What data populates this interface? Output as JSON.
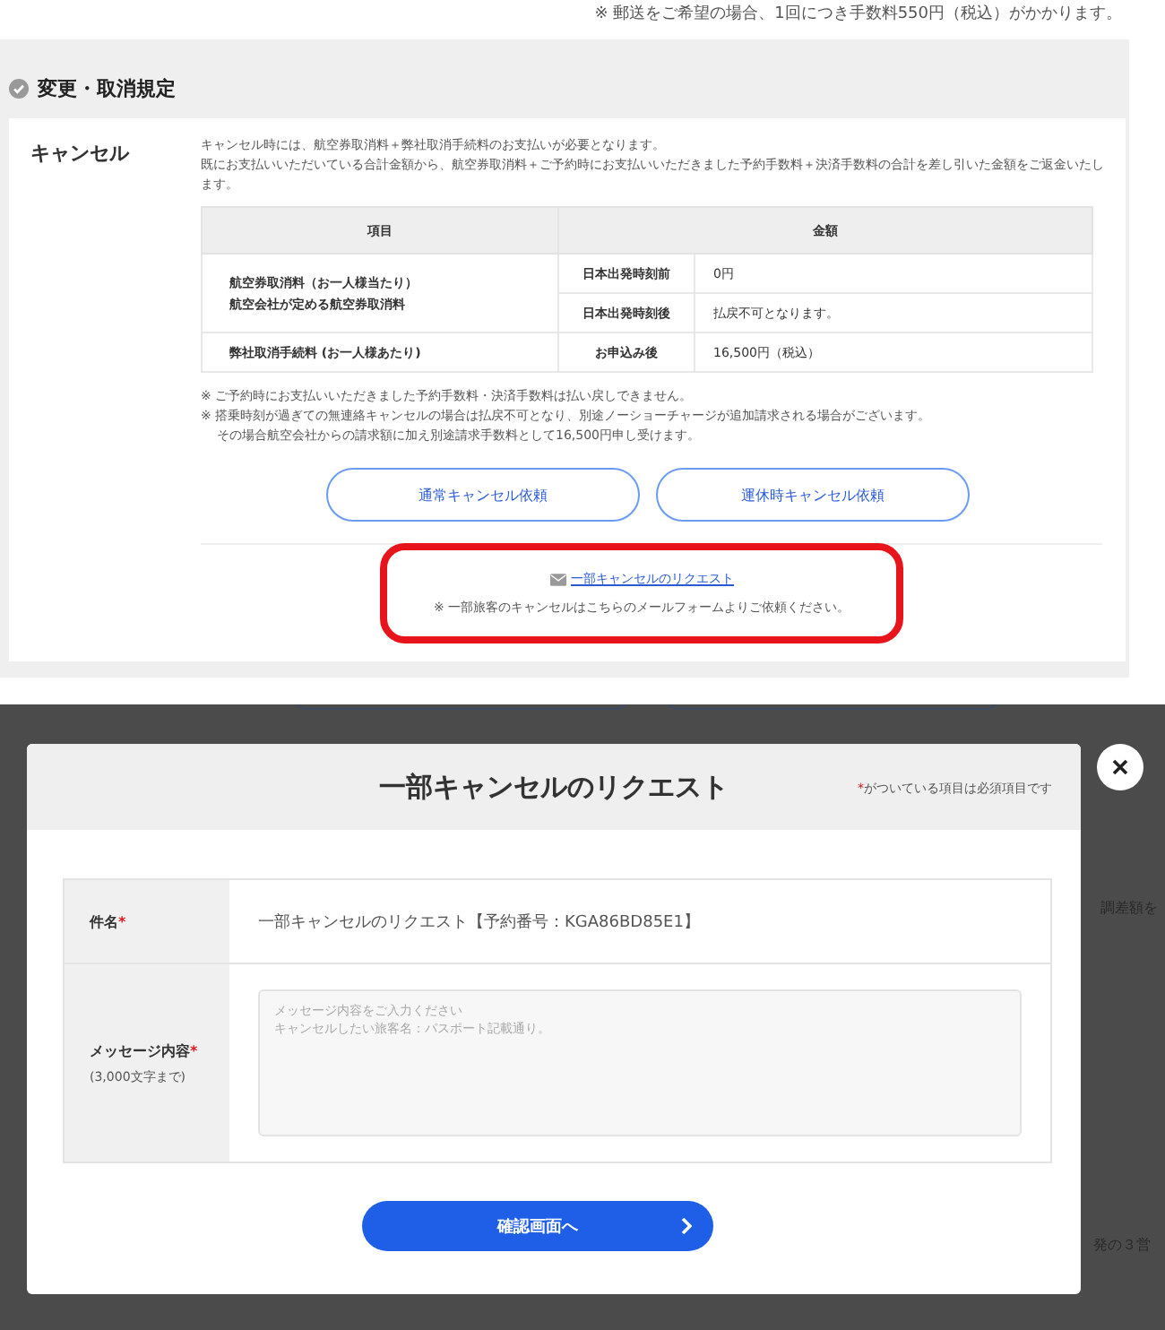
{
  "top_note": "※ 郵送をご希望の場合、1回につき手数料550円（税込）がかかります。",
  "section": {
    "title": "変更・取消規定",
    "cancel": {
      "label": "キャンセル",
      "paragraphs": [
        "キャンセル時には、航空券取消料＋弊社取消手続料のお支払いが必要となります。",
        "既にお支払いいただいている合計金額から、航空券取消料＋ご予約時にお支払いいただきました予約手数料＋決済手数料の合計を差し引いた金額をご返金いたします。"
      ],
      "table": {
        "columns": [
          "項目",
          "金額"
        ],
        "rows": [
          {
            "item": [
              "航空券取消料（お一人様当たり）",
              "航空会社が定める航空券取消料"
            ],
            "periods": [
              {
                "timing": "日本出発時刻前",
                "amount": "0円"
              },
              {
                "timing": "日本出発時刻後",
                "amount": "払戻不可となります。"
              }
            ]
          },
          {
            "item": [
              "弊社取消手続料 (お一人様あたり)"
            ],
            "periods": [
              {
                "timing": "お申込み後",
                "amount": "16,500円（税込）"
              }
            ]
          }
        ]
      },
      "notes": [
        "※ ご予約時にお支払いいただきました予約手数料・決済手数料は払い戻しできません。",
        "※ 搭乗時刻が過ぎての無連絡キャンセルの場合は払戻不可となり、別途ノーショーチャージが追加請求される場合がございます。",
        "その場合航空会社からの請求額に加え別途請求手数料として16,500円申し受けます。"
      ],
      "buttons": [
        "通常キャンセル依頼",
        "運休時キャンセル依頼"
      ],
      "partial": {
        "link": "一部キャンセルのリクエスト",
        "note": "※ 一部旅客のキャンセルはこちらのメールフォームよりご依頼ください。",
        "highlighted": true
      }
    }
  },
  "background_fragments": [
    "調差額を",
    "発の３営"
  ],
  "modal": {
    "title": "一部キャンセルのリクエスト",
    "required_note": {
      "mark": "*",
      "text": "がついている項目は必須項目です"
    },
    "fields": [
      {
        "kind": "text",
        "label": "件名",
        "required_mark": "*",
        "value": "一部キャンセルのリクエスト【予約番号：KGA86BD85E1】"
      },
      {
        "kind": "textarea",
        "label": "メッセージ内容",
        "required_mark": "*",
        "sublabel": "(3,000文字まで)",
        "placeholder": [
          "メッセージ内容をご入力ください",
          "キャンセルしたい旅客名：パスポート記載通り。"
        ]
      }
    ],
    "submit": "確認画面へ"
  }
}
